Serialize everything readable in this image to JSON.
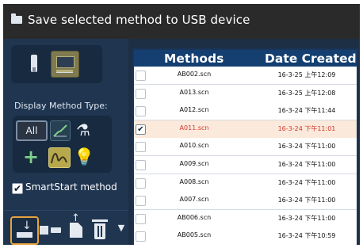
{
  "window": {
    "title": "Save selected method to USB device",
    "title_icon": "folder-icon"
  },
  "sidebar": {
    "device_icons": [
      "usb-device-icon",
      "instrument-icon"
    ],
    "display_method_type_label": "Display Method Type:",
    "method_types": {
      "all_label": "All",
      "icons": [
        "curve-icon",
        "flask-icon",
        "plus-icon",
        "scan-icon",
        "bulb-icon"
      ]
    },
    "smartstart": {
      "checked_symbol": "✔",
      "label": "SmartStart method"
    },
    "toolbar_icons": [
      "save-to-usb-icon",
      "usb-transfer-icon",
      "document-upload-icon",
      "trash-icon",
      "chevron-down-icon"
    ]
  },
  "table": {
    "headers": {
      "methods": "Methods",
      "date_created": "Date Created"
    },
    "rows": [
      {
        "name": "AB002.scn",
        "date": "16-3-25 上午12:09",
        "checked": false
      },
      {
        "name": "A013.scn",
        "date": "16-3-25 上午12:08",
        "checked": false
      },
      {
        "name": "A012.scn",
        "date": "16-3-24 下午11:44",
        "checked": false
      },
      {
        "name": "A011.scn",
        "date": "16-3-24 下午11:01",
        "checked": true
      },
      {
        "name": "A010.scn",
        "date": "16-3-24 下午11:00",
        "checked": false
      },
      {
        "name": "A009.scn",
        "date": "16-3-24 下午11:00",
        "checked": false
      },
      {
        "name": "A008.scn",
        "date": "16-3-24 下午11:00",
        "checked": false
      },
      {
        "name": "A007.scn",
        "date": "16-3-24 下午11:00",
        "checked": false
      },
      {
        "name": "AB006.scn",
        "date": "16-3-24 下午11:00",
        "checked": false
      },
      {
        "name": "AB005.scn",
        "date": "16-3-24 下午10:59",
        "checked": false
      }
    ],
    "selected_checkbox_symbol": "✔"
  },
  "colors": {
    "header_blue": "#143f70",
    "selected_row_bg": "#fbe9dc",
    "selected_text": "#d2392a",
    "accent_orange": "#e8a33d"
  }
}
